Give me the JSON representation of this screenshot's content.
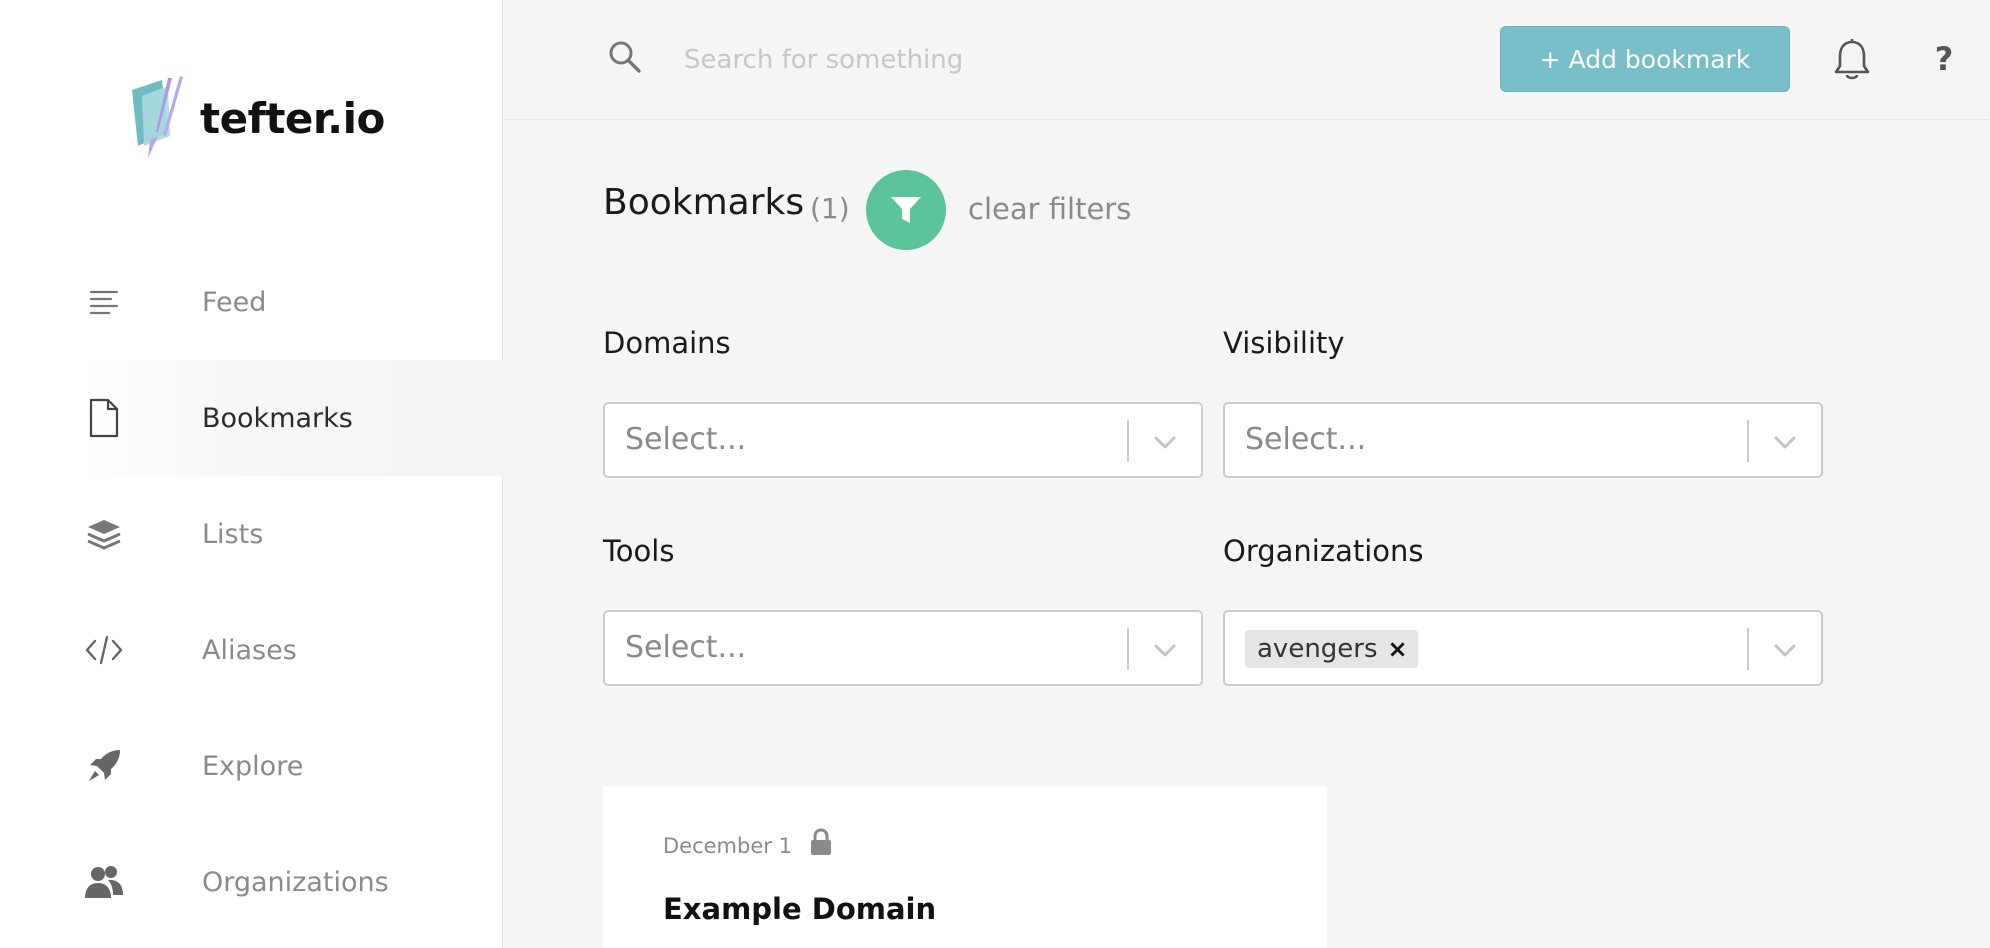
{
  "app": {
    "logo_text": "tefter.io"
  },
  "sidebar": {
    "items": [
      {
        "label": "Feed",
        "icon": "feed-lines-icon",
        "active": false
      },
      {
        "label": "Bookmarks",
        "icon": "document-icon",
        "active": true
      },
      {
        "label": "Lists",
        "icon": "layers-icon",
        "active": false
      },
      {
        "label": "Aliases",
        "icon": "code-icon",
        "active": false
      },
      {
        "label": "Explore",
        "icon": "rocket-icon",
        "active": false
      },
      {
        "label": "Organizations",
        "icon": "users-icon",
        "active": false
      }
    ]
  },
  "topbar": {
    "search_placeholder": "Search for something",
    "add_bookmark_label": "+ Add bookmark",
    "help_label": "?"
  },
  "main": {
    "title": "Bookmarks",
    "count": "(1)",
    "clear_filters": "clear filters",
    "filters": {
      "domains": {
        "label": "Domains",
        "placeholder": "Select..."
      },
      "visibility": {
        "label": "Visibility",
        "placeholder": "Select..."
      },
      "tools": {
        "label": "Tools",
        "placeholder": "Select..."
      },
      "organizations": {
        "label": "Organizations",
        "selected_tag": "avengers",
        "remove_glyph": "×"
      }
    },
    "bookmark": {
      "date": "December 1",
      "title": "Example Domain"
    }
  },
  "colors": {
    "accent_button": "#79bfc9",
    "filter_button": "#5cc49b"
  }
}
